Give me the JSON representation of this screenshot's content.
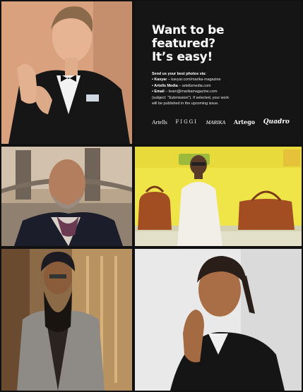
{
  "headline": [
    "Want to be",
    "featured?",
    "It’s easy!"
  ],
  "intro": "Send us your best photos via:",
  "channels": [
    {
      "label": "• Kavyar",
      "detail": " – kavyar.com/marika-magazine"
    },
    {
      "label": "• Artells Media",
      "detail": " – artellsmedia.com"
    },
    {
      "label": "• Email",
      "detail": " – team@marikamagazine.com"
    }
  ],
  "note_lines": [
    "(subject: “Submission”). If selected, your work",
    "will be published in the upcoming issue."
  ],
  "logos": [
    "Artells",
    "FIGGI",
    "MARIKA",
    "Artego",
    "Quadro"
  ],
  "colors": {
    "promo_bg": "#151515",
    "text": "#ffffff",
    "gutter": "#111111"
  },
  "photos": [
    {
      "id": "young-man-tuxedo",
      "desc": "young man in black tuxedo with bow tie adjusting cuff"
    },
    {
      "id": "bald-man-london",
      "desc": "older bald man in velvet blazer near Tower Bridge"
    },
    {
      "id": "man-white-suit-bags",
      "desc": "man in white suit with leather bags on yellow bench"
    },
    {
      "id": "man-turban-blazer",
      "desc": "man with turban and long beard in grey blazer"
    },
    {
      "id": "young-man-braids",
      "desc": "young man with braided hair in black shirt"
    }
  ]
}
